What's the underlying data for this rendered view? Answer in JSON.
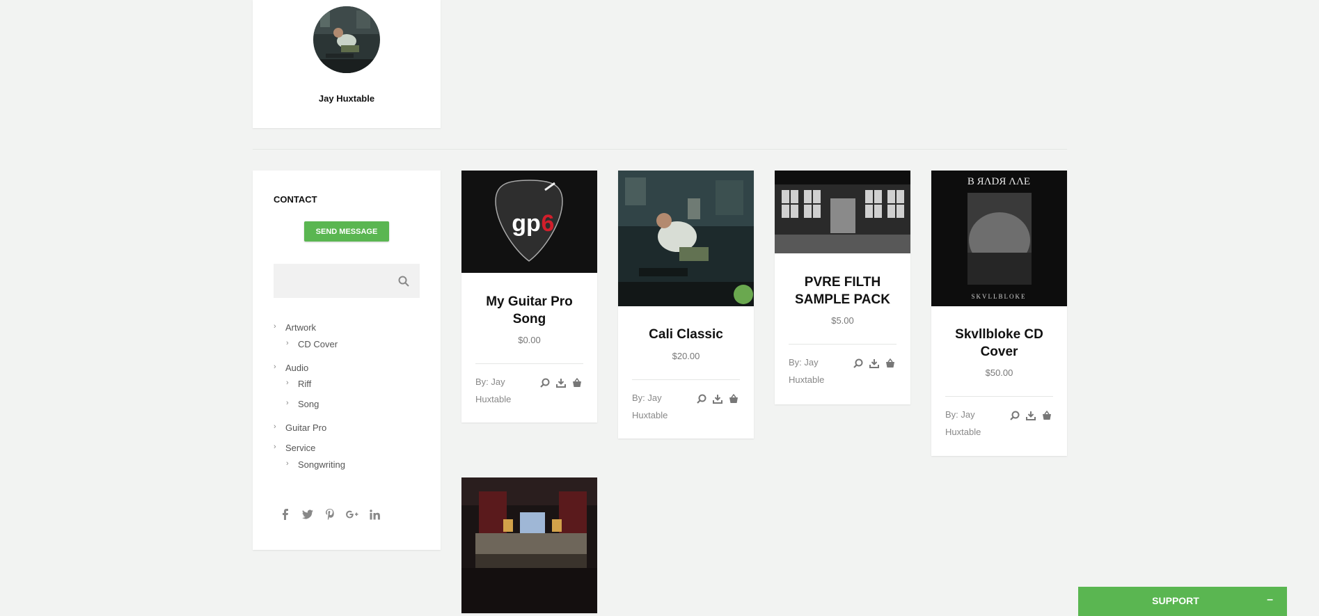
{
  "profile": {
    "name": "Jay Huxtable"
  },
  "sidebar": {
    "contact_title": "CONTACT",
    "send_message": "SEND MESSAGE",
    "search_placeholder": "",
    "categories": [
      {
        "label": "Artwork",
        "children": [
          "CD Cover"
        ]
      },
      {
        "label": "Audio",
        "children": [
          "Riff",
          "Song"
        ]
      },
      {
        "label": "Guitar Pro",
        "children": []
      },
      {
        "label": "Service",
        "children": [
          "Songwriting"
        ]
      }
    ],
    "socials": [
      "facebook-icon",
      "twitter-icon",
      "pinterest-icon",
      "google-plus-icon",
      "linkedin-icon"
    ]
  },
  "products": [
    {
      "title": "My Guitar Pro Song",
      "price": "$0.00",
      "by": "By: Jay Huxtable",
      "image_text": "gp6"
    },
    {
      "title": "Cali Classic",
      "price": "$20.00",
      "by": "By: Jay Huxtable"
    },
    {
      "title": "PVRE FILTH SAMPLE PACK",
      "price": "$5.00",
      "by": "By: Jay Huxtable"
    },
    {
      "title": "Skvllbloke CD Cover",
      "price": "$50.00",
      "by": "By: Jay Huxtable",
      "image_text_top": "B ЯΛDЯ ΛΛE",
      "image_text_bottom": "SKVLLBLOKE"
    }
  ],
  "support": {
    "label": "SUPPORT",
    "minimize": "–"
  },
  "colors": {
    "accent": "#5ab651",
    "background": "#f2f3f2"
  }
}
